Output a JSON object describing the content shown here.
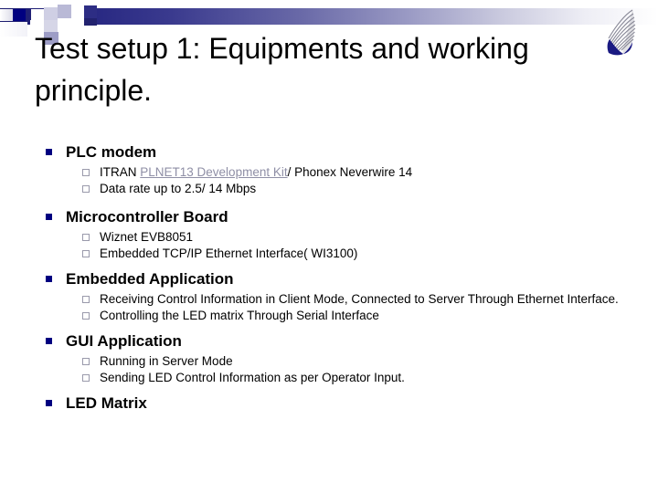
{
  "slide": {
    "title": "Test setup 1: Equipments and working principle.",
    "logo_icon": "wing-feather-logo",
    "colors": {
      "bullet_navy": "#000080",
      "band_dark": "#1c1c6e",
      "link_gray": "#8f8fa6",
      "text_black": "#000000",
      "background": "#ffffff"
    },
    "sections": [
      {
        "heading": "PLC modem",
        "items": [
          {
            "pre": "ITRAN ",
            "link": "PLNET13 Development Kit",
            "post": "/ Phonex Neverwire 14"
          },
          {
            "text": "Data rate up to 2.5/ 14 Mbps"
          }
        ]
      },
      {
        "heading": "Microcontroller Board",
        "items": [
          {
            "text": "Wiznet EVB8051"
          },
          {
            "text": "Embedded TCP/IP Ethernet Interface( WI3100)"
          }
        ]
      },
      {
        "heading": "Embedded Application",
        "items": [
          {
            "text": "Receiving Control Information in Client Mode, Connected to Server Through Ethernet Interface."
          },
          {
            "text": "Controlling the LED matrix Through Serial Interface"
          }
        ]
      },
      {
        "heading": "GUI Application",
        "items": [
          {
            "text": "Running in Server Mode"
          },
          {
            "text": "Sending LED Control Information as per Operator Input."
          }
        ]
      },
      {
        "heading": "LED Matrix",
        "items": []
      }
    ]
  }
}
